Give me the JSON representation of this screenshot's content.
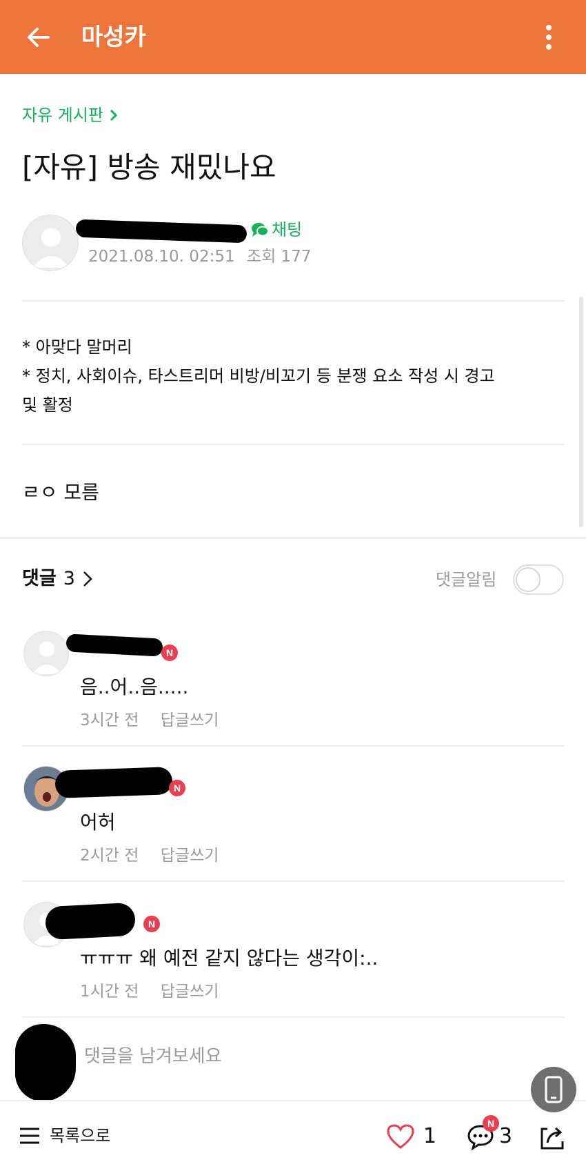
{
  "topbar": {
    "title": "마성카",
    "accent_color": "#ee7539"
  },
  "post": {
    "board": "자유 게시판",
    "title": "[자유] 방송 재밌나요",
    "chat_label": "채팅",
    "date": "2021.08.10. 02:51",
    "views_label": "조회 177",
    "notice": [
      "* 아맞다 말머리",
      "* 정치, 사회이슈, 타스트리머 비방/비꼬기 등 분쟁 요소 작성 시 경고",
      "및 활정"
    ],
    "body": "ㄹㅇ 모름"
  },
  "comments_header": {
    "label": "댓글",
    "count": "3",
    "notify_label": "댓글알림",
    "notify_on": false
  },
  "comments": [
    {
      "text": "음..어..음.....",
      "time": "3시간 전",
      "reply_label": "답글쓰기",
      "badge": "N"
    },
    {
      "text": "어허",
      "time": "2시간 전",
      "reply_label": "답글쓰기",
      "badge": "N"
    },
    {
      "text": "ㅠㅠㅠ 왜 예전 같지 않다는 생각이:..",
      "time": "1시간 전",
      "reply_label": "답글쓰기",
      "badge": "N"
    }
  ],
  "reply_input": {
    "placeholder": "댓글을 남겨보세요"
  },
  "bottombar": {
    "list_label": "목록으로",
    "likes": "1",
    "comments": "3",
    "comment_badge": "N"
  },
  "icons": [
    "back-arrow-icon",
    "more-vertical-icon",
    "chevron-right-icon",
    "chat-bubble-icon",
    "person-icon",
    "heart-icon",
    "comment-icon",
    "share-icon",
    "menu-icon",
    "phone-icon"
  ]
}
